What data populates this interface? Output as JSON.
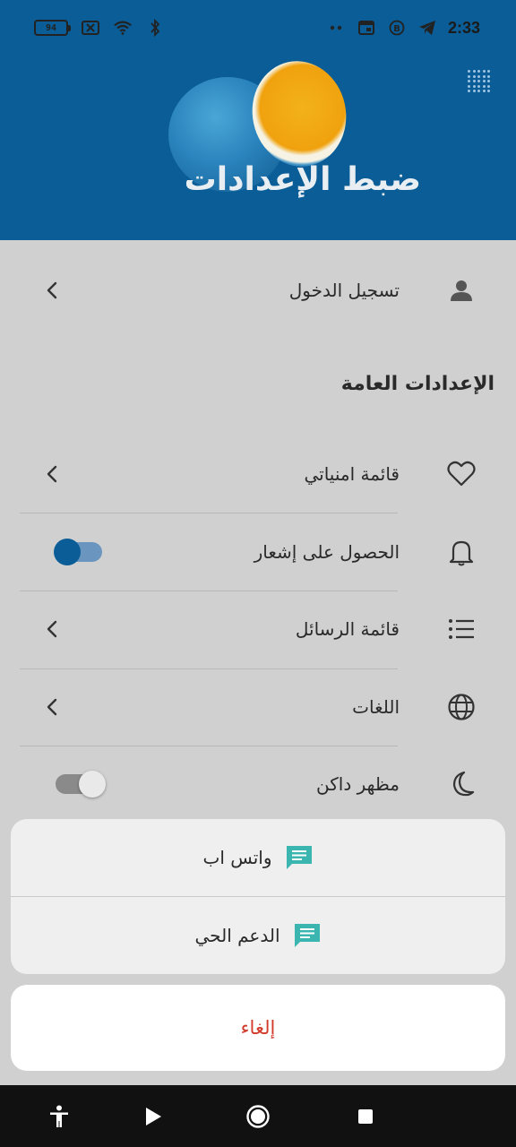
{
  "status_bar": {
    "battery_level": "94",
    "time": "2:33",
    "icons": [
      "battery-icon",
      "sim-off-icon",
      "wifi-icon",
      "bluetooth-icon",
      "dots-icon",
      "calendar-icon",
      "b-app-icon",
      "telegram-icon"
    ]
  },
  "header": {
    "title": "ضبط الإعدادات",
    "grid_icon": "dots-grid-icon"
  },
  "account": {
    "login_label": "تسجيل الدخول",
    "icon": "person-icon"
  },
  "general": {
    "section_title": "الإعدادات العامة",
    "items": [
      {
        "label": "قائمة امنياتي",
        "icon": "heart-icon",
        "control": "chevron"
      },
      {
        "label": "الحصول على إشعار",
        "icon": "bell-icon",
        "control": "toggle",
        "on": true
      },
      {
        "label": "قائمة الرسائل",
        "icon": "list-icon",
        "control": "chevron"
      },
      {
        "label": "اللغات",
        "icon": "globe-icon",
        "control": "chevron"
      },
      {
        "label": "مظهر داكن",
        "icon": "moon-icon",
        "control": "toggle",
        "on": false
      }
    ]
  },
  "sheet": {
    "options": [
      {
        "label": "واتس اب",
        "icon": "chat-icon"
      },
      {
        "label": "الدعم الحي",
        "icon": "chat-icon"
      }
    ],
    "cancel_label": "إلغاء"
  },
  "colors": {
    "header_blue": "#0a5d96",
    "accent_teal": "#3bb5b0",
    "cancel_red": "#d23a2c",
    "toggle_on": "#0a5d96"
  },
  "navbar": {
    "buttons": [
      "accessibility-icon",
      "back-icon",
      "home-icon",
      "recents-icon"
    ]
  }
}
